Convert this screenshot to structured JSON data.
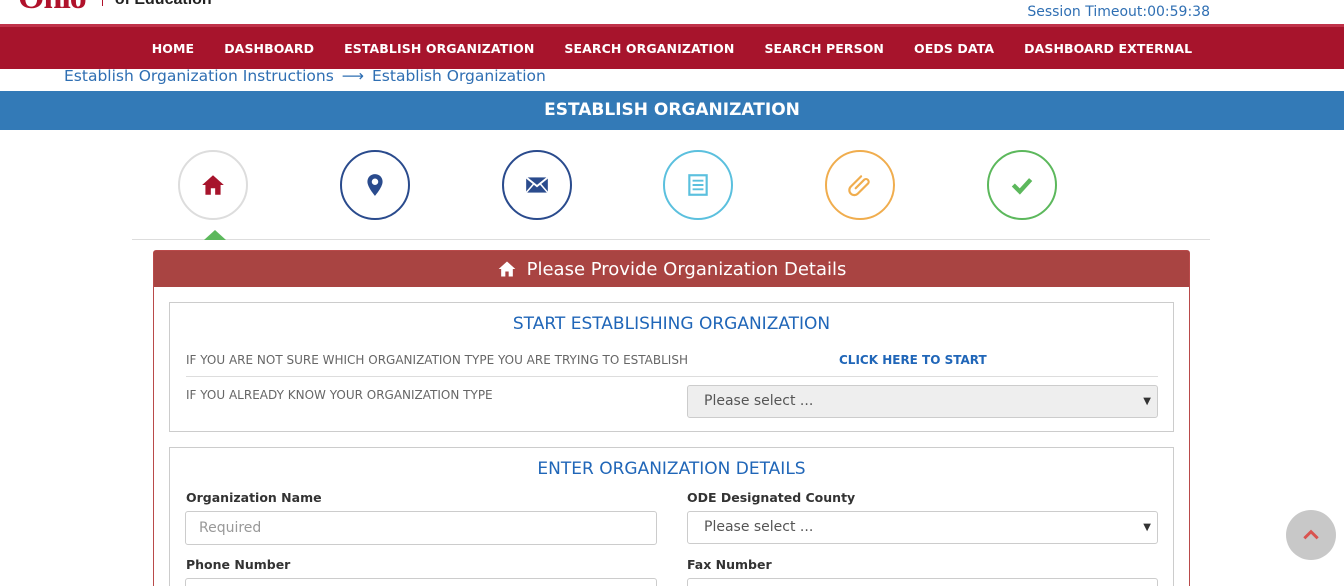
{
  "header": {
    "logo_mark": "Ohio",
    "logo_sub": "of Education",
    "session_timeout": "Session Timeout:00:59:38"
  },
  "nav": {
    "items": [
      "HOME",
      "DASHBOARD",
      "ESTABLISH ORGANIZATION",
      "SEARCH ORGANIZATION",
      "SEARCH PERSON",
      "OEDS DATA",
      "DASHBOARD EXTERNAL"
    ]
  },
  "breadcrumb": {
    "parent": "Establish Organization Instructions",
    "separator": "⟶",
    "current": "Establish Organization"
  },
  "page_title": "ESTABLISH ORGANIZATION",
  "steps": [
    {
      "icon": "home-icon",
      "color": "#a7142c",
      "border": "#dddddd",
      "active": true
    },
    {
      "icon": "map-marker-icon",
      "color": "#2a4b8d",
      "border": "#2a4b8d",
      "active": false
    },
    {
      "icon": "envelope-icon",
      "color": "#2a4b8d",
      "border": "#2a4b8d",
      "active": false
    },
    {
      "icon": "list-icon",
      "color": "#5bc0de",
      "border": "#5bc0de",
      "active": false
    },
    {
      "icon": "paperclip-icon",
      "color": "#f0ad4e",
      "border": "#f0ad4e",
      "active": false
    },
    {
      "icon": "check-icon",
      "color": "#5cb85c",
      "border": "#5cb85c",
      "active": false
    }
  ],
  "panel": {
    "title": "Please Provide Organization Details",
    "section_start": {
      "title": "START ESTABLISHING ORGANIZATION",
      "not_sure_label": "IF YOU ARE NOT SURE WHICH ORGANIZATION TYPE YOU ARE TRYING TO ESTABLISH",
      "not_sure_link": "CLICK HERE TO START",
      "know_label": "IF YOU ALREADY KNOW YOUR ORGANIZATION TYPE",
      "type_select": "Please select ..."
    },
    "section_details": {
      "title": "ENTER ORGANIZATION DETAILS",
      "org_name_label": "Organization Name",
      "org_name_placeholder": "Required",
      "county_label": "ODE Designated County",
      "county_select": "Please select ...",
      "phone_label": "Phone Number",
      "fax_label": "Fax Number"
    }
  },
  "colors": {
    "brand_red": "#a7142c",
    "title_blue": "#337ab7",
    "panel_red": "#a94442",
    "link_blue": "#2066b8"
  }
}
